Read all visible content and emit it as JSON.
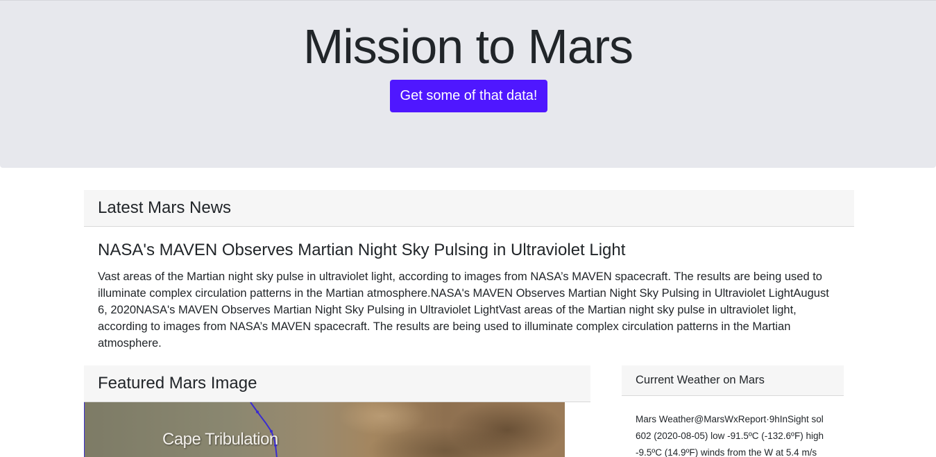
{
  "header": {
    "title": "Mission to Mars",
    "button_label": "Get some of that data!"
  },
  "news": {
    "section_title": "Latest Mars News",
    "headline": "NASA's MAVEN Observes Martian Night Sky Pulsing in Ultraviolet Light",
    "body": "Vast areas of the Martian night sky pulse in ultraviolet light, according to images from NASA’s MAVEN spacecraft. The results are being used to illuminate complex circulation patterns in the Martian atmosphere.NASA's MAVEN Observes Martian Night Sky Pulsing in Ultraviolet LightAugust 6, 2020NASA's MAVEN Observes Martian Night Sky Pulsing in Ultraviolet LightVast areas of the Martian night sky pulse in ultraviolet light, according to images from NASA’s MAVEN spacecraft. The results are being used to illuminate complex circulation patterns in the Martian atmosphere."
  },
  "featured": {
    "section_title": "Featured Mars Image",
    "image_caption": "Cape Tribulation"
  },
  "weather": {
    "section_title": "Current Weather on Mars",
    "report": "Mars Weather@MarsWxReport·9hInSight sol 602 (2020-08-05) low -91.5ºC (-132.6ºF) high -9.5ºC (14.9ºF) winds from the W at 5.4 m/s"
  },
  "colors": {
    "accent": "#4f17ff",
    "jumbotron_bg": "#e7e8ed",
    "card_header_bg": "#f6f6f6"
  }
}
